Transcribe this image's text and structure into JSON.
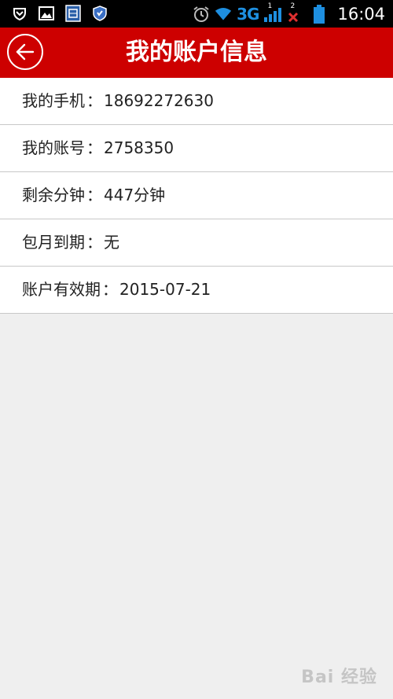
{
  "status_bar": {
    "left_icons": [
      "shield-down-icon",
      "image-icon",
      "sim-app-icon",
      "security-shield-icon"
    ],
    "right_icons": [
      "alarm-icon",
      "wifi-icon",
      "signal-icon",
      "no-sim-icon",
      "battery-icon"
    ],
    "network": "3G",
    "sim_index": "1",
    "sim2_index": "2",
    "time": "16:04"
  },
  "header": {
    "title": "我的账户信息",
    "back_icon": "arrow-left-icon",
    "color": "#cd0000"
  },
  "info": [
    {
      "label": "我的手机",
      "value": "18692272630"
    },
    {
      "label": "我的账号",
      "value": "2758350"
    },
    {
      "label": "剩余分钟",
      "value": "447分钟"
    },
    {
      "label": "包月到期",
      "value": "无"
    },
    {
      "label": "账户有效期",
      "value": "2015-07-21"
    }
  ],
  "separator": "：",
  "watermark": "Bai 经验"
}
